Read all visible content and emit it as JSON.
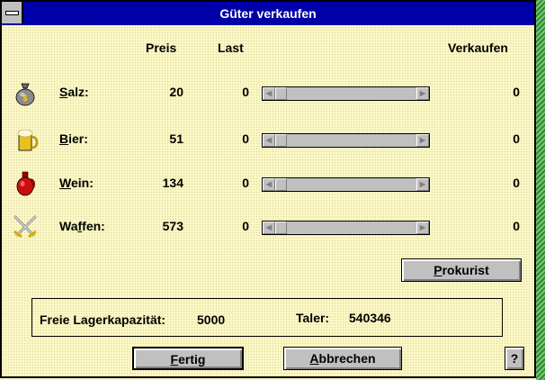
{
  "window": {
    "title": "Güter verkaufen"
  },
  "columns": {
    "price": "Preis",
    "load": "Last",
    "sell": "Verkaufen"
  },
  "goods": [
    {
      "pre": "",
      "mnem": "S",
      "post": "alz:",
      "price": "20",
      "load": "0",
      "sell": "0",
      "icon": "money-bag-icon"
    },
    {
      "pre": "",
      "mnem": "B",
      "post": "ier:",
      "price": "51",
      "load": "0",
      "sell": "0",
      "icon": "beer-mug-icon"
    },
    {
      "pre": "",
      "mnem": "W",
      "post": "ein:",
      "price": "134",
      "load": "0",
      "sell": "0",
      "icon": "wine-jug-icon"
    },
    {
      "pre": "Wa",
      "mnem": "f",
      "post": "fen:",
      "price": "573",
      "load": "0",
      "sell": "0",
      "icon": "crossed-swords-icon"
    }
  ],
  "buttons": {
    "prokurist": {
      "mnem": "P",
      "rest": "rokurist"
    },
    "fertig": {
      "mnem": "F",
      "rest": "ertig"
    },
    "abbrechen": {
      "mnem": "A",
      "rest": "bbrechen"
    },
    "help": "?"
  },
  "info": {
    "capacity_label": "Freie Lagerkapazität:",
    "capacity_value": "5000",
    "taler_label": "Taler:",
    "taler_value": "540346"
  },
  "colors": {
    "background": "#fbf7c4",
    "title_bar": "#0000a8",
    "button_face": "#c0c0c0"
  }
}
